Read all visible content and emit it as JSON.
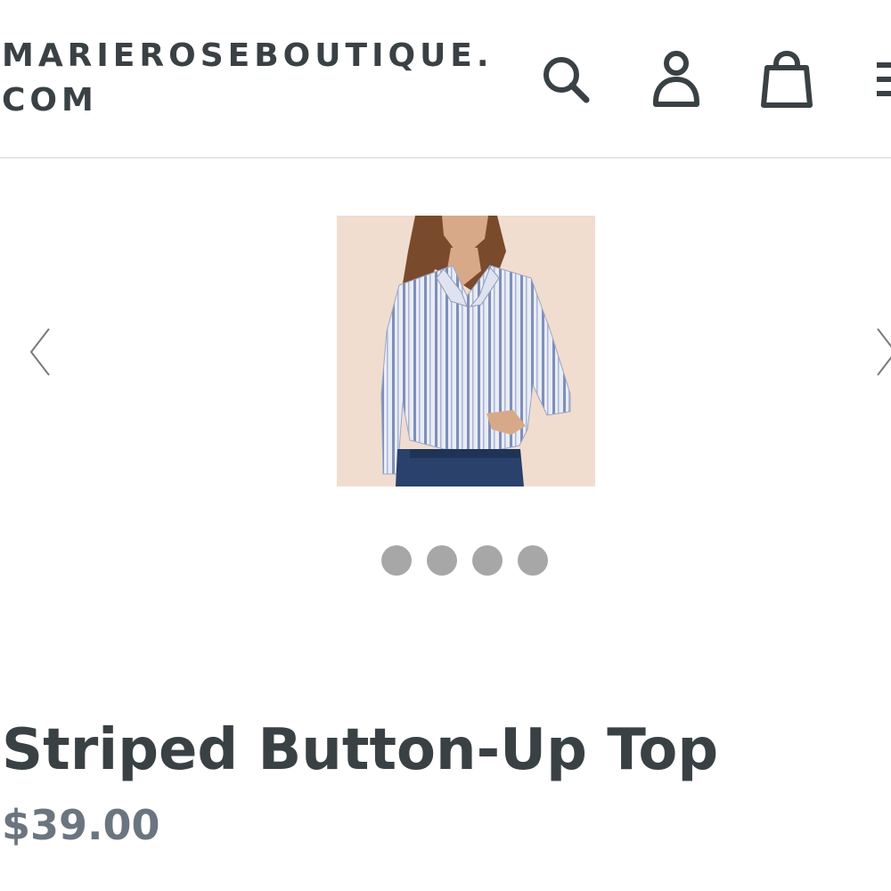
{
  "header": {
    "brand_line1": "MARIEROSEBOUTIQUE.",
    "brand_line2": "COM",
    "icons": [
      "search-icon",
      "account-icon",
      "cart-icon",
      "menu-icon"
    ]
  },
  "gallery": {
    "image_alt": "Striped Button-Up Top",
    "dots_count": 4,
    "prev_icon": "chevron-left-icon",
    "next_icon": "chevron-right-icon"
  },
  "product": {
    "title": "Striped Button-Up Top",
    "price": "$39.00"
  },
  "colors": {
    "text": "#3a4145",
    "price": "#6b7580",
    "dot": "#a7a7a7",
    "image_background": "#f1ddcf",
    "shirt_stripe": "#7f8fb8",
    "jeans": "#29416b"
  }
}
